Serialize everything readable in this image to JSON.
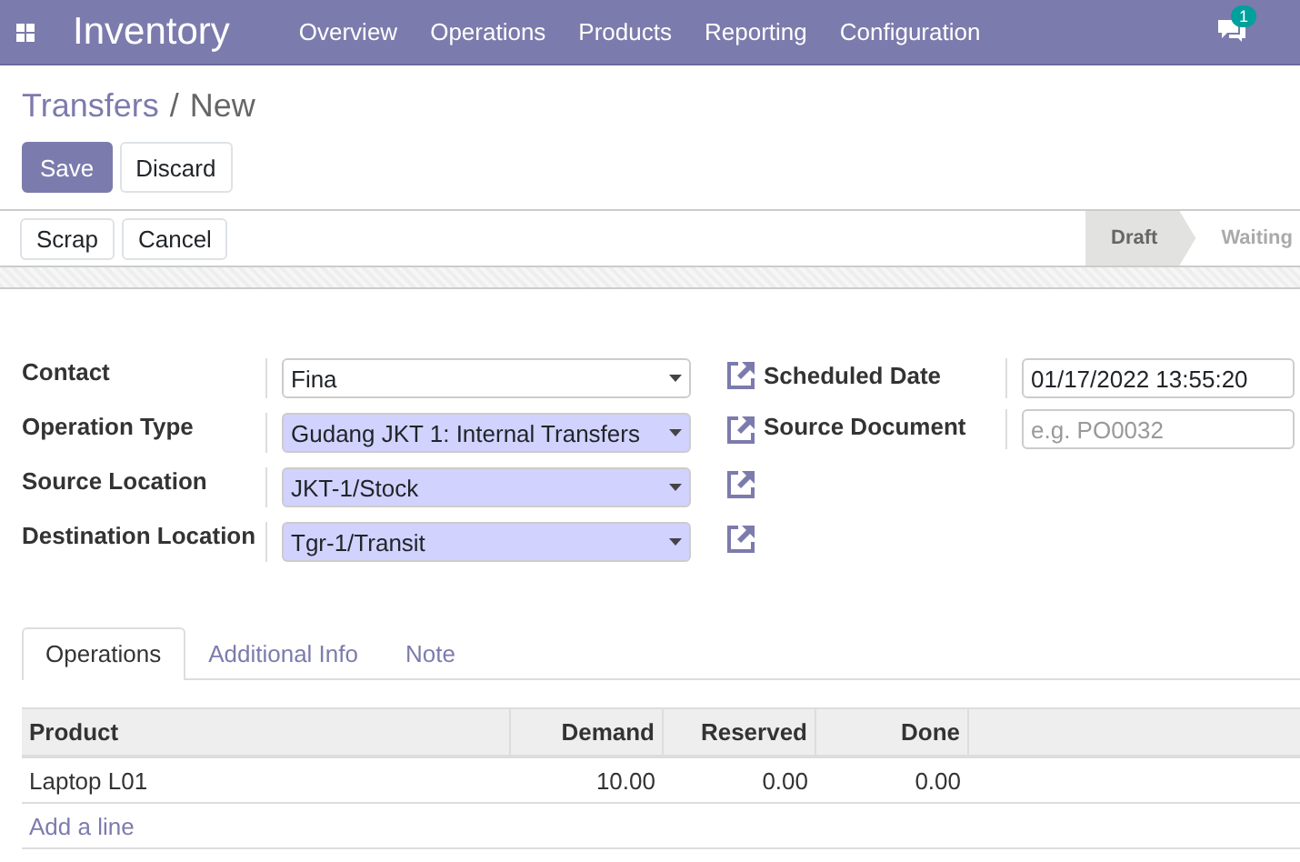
{
  "navbar": {
    "app_name": "Inventory",
    "menu": [
      "Overview",
      "Operations",
      "Products",
      "Reporting",
      "Configuration"
    ],
    "messages_badge": "1"
  },
  "breadcrumb": [
    {
      "label": "Transfers",
      "kind": "link"
    },
    {
      "label": "/",
      "kind": "separator"
    },
    {
      "label": "New",
      "kind": "current"
    }
  ],
  "buttons": [
    {
      "label": "Save",
      "kind": "primary"
    },
    {
      "label": "Discard",
      "kind": "secondary"
    }
  ],
  "status_actions": [
    "Scrap",
    "Cancel"
  ],
  "stages": [
    {
      "label": "Draft",
      "selected": true
    },
    {
      "label": "Waiting",
      "selected": false
    }
  ],
  "left_fields": [
    {
      "label": "Contact",
      "value": "Fina",
      "required": false
    },
    {
      "label": "Operation Type",
      "value": "Gudang JKT 1: Internal Transfers",
      "required": true
    },
    {
      "label": "Source Location",
      "value": "JKT-1/Stock",
      "required": true
    },
    {
      "label": "Destination Location",
      "value": "Tgr-1/Transit",
      "required": true
    }
  ],
  "right_fields": [
    {
      "label": "Scheduled Date",
      "value": "01/17/2022 13:55:20"
    },
    {
      "label": "Source Document",
      "placeholder": "e.g. PO0032"
    }
  ],
  "tabs": [
    {
      "label": "Operations",
      "selected": true
    },
    {
      "label": "Additional Info",
      "selected": false
    },
    {
      "label": "Note",
      "selected": false
    }
  ],
  "table": {
    "columns": [
      {
        "label": "Product",
        "kind": "text"
      },
      {
        "label": "Demand",
        "kind": "number"
      },
      {
        "label": "Reserved",
        "kind": "number"
      },
      {
        "label": "Done",
        "kind": "number"
      }
    ],
    "rows": [
      [
        "Laptop L01",
        "10.00",
        "0.00",
        "0.00"
      ]
    ],
    "add_line": "Add a line"
  }
}
